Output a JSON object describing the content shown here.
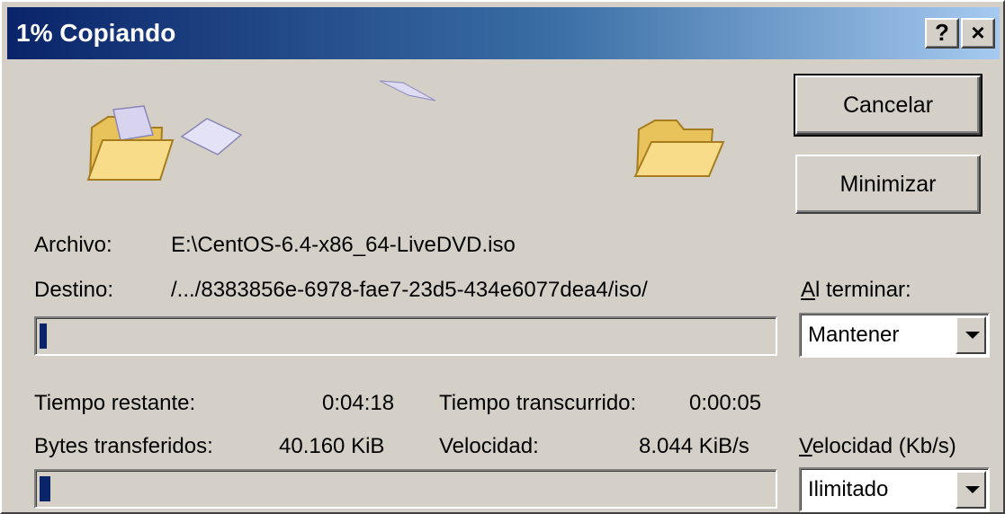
{
  "window": {
    "title": "1% Copiando",
    "help_label": "?",
    "close_label": "×"
  },
  "buttons": {
    "cancel": "Cancelar",
    "minimize": "Minimizar"
  },
  "file": {
    "archivo_label": "Archivo:",
    "archivo_value": "E:\\CentOS-6.4-x86_64-LiveDVD.iso",
    "destino_label": "Destino:",
    "destino_value": "/.../8383856e-6978-fae7-23d5-434e6077dea4/iso/"
  },
  "on_finish": {
    "label_accel": "A",
    "label_rest": "l terminar:",
    "selected": "Mantener"
  },
  "stats": {
    "remaining_label": "Tiempo restante:",
    "remaining_value": "0:04:18",
    "elapsed_label": "Tiempo transcurrido:",
    "elapsed_value": "0:00:05",
    "bytes_label": "Bytes transferidos:",
    "bytes_value": "40.160 KiB",
    "speed_label": "Velocidad:",
    "speed_value": "8.044 KiB/s"
  },
  "speed_limit": {
    "label_accel": "V",
    "label_rest": "elocidad (Kb/s)",
    "selected": "Ilimitado"
  },
  "progress": {
    "file_fraction": 0.01,
    "total_fraction": 0.015
  },
  "icons": [
    "source-folder-icon",
    "flying-document-icon",
    "destination-folder-icon"
  ]
}
